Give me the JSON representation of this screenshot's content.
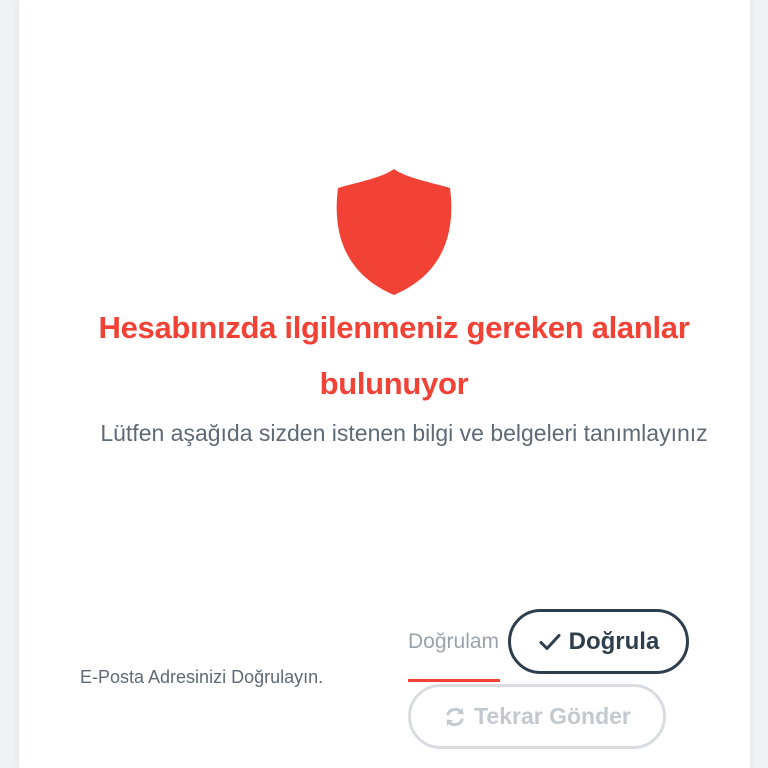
{
  "colors": {
    "accent": "#f24236",
    "text_muted": "#5e6a76",
    "button_dark": "#2f3e4d",
    "button_disabled": "#c3c9ce"
  },
  "alert": {
    "icon": "shield-icon",
    "title": "Hesabınızda ilgilenmeniz gereken alanlar bulunuyor",
    "subtitle": "Lütfen aşağıda sizden istenen bilgi ve belgeleri tanımlayınız"
  },
  "email_verification": {
    "label": "E-Posta Adresinizi Doğrulayın.",
    "code_placeholder": "Doğrulama Kodu",
    "verify_button": {
      "icon": "check-icon",
      "label": "Doğrula"
    },
    "resend_button": {
      "icon": "refresh-icon",
      "label": "Tekrar Gönder",
      "disabled": true
    }
  }
}
